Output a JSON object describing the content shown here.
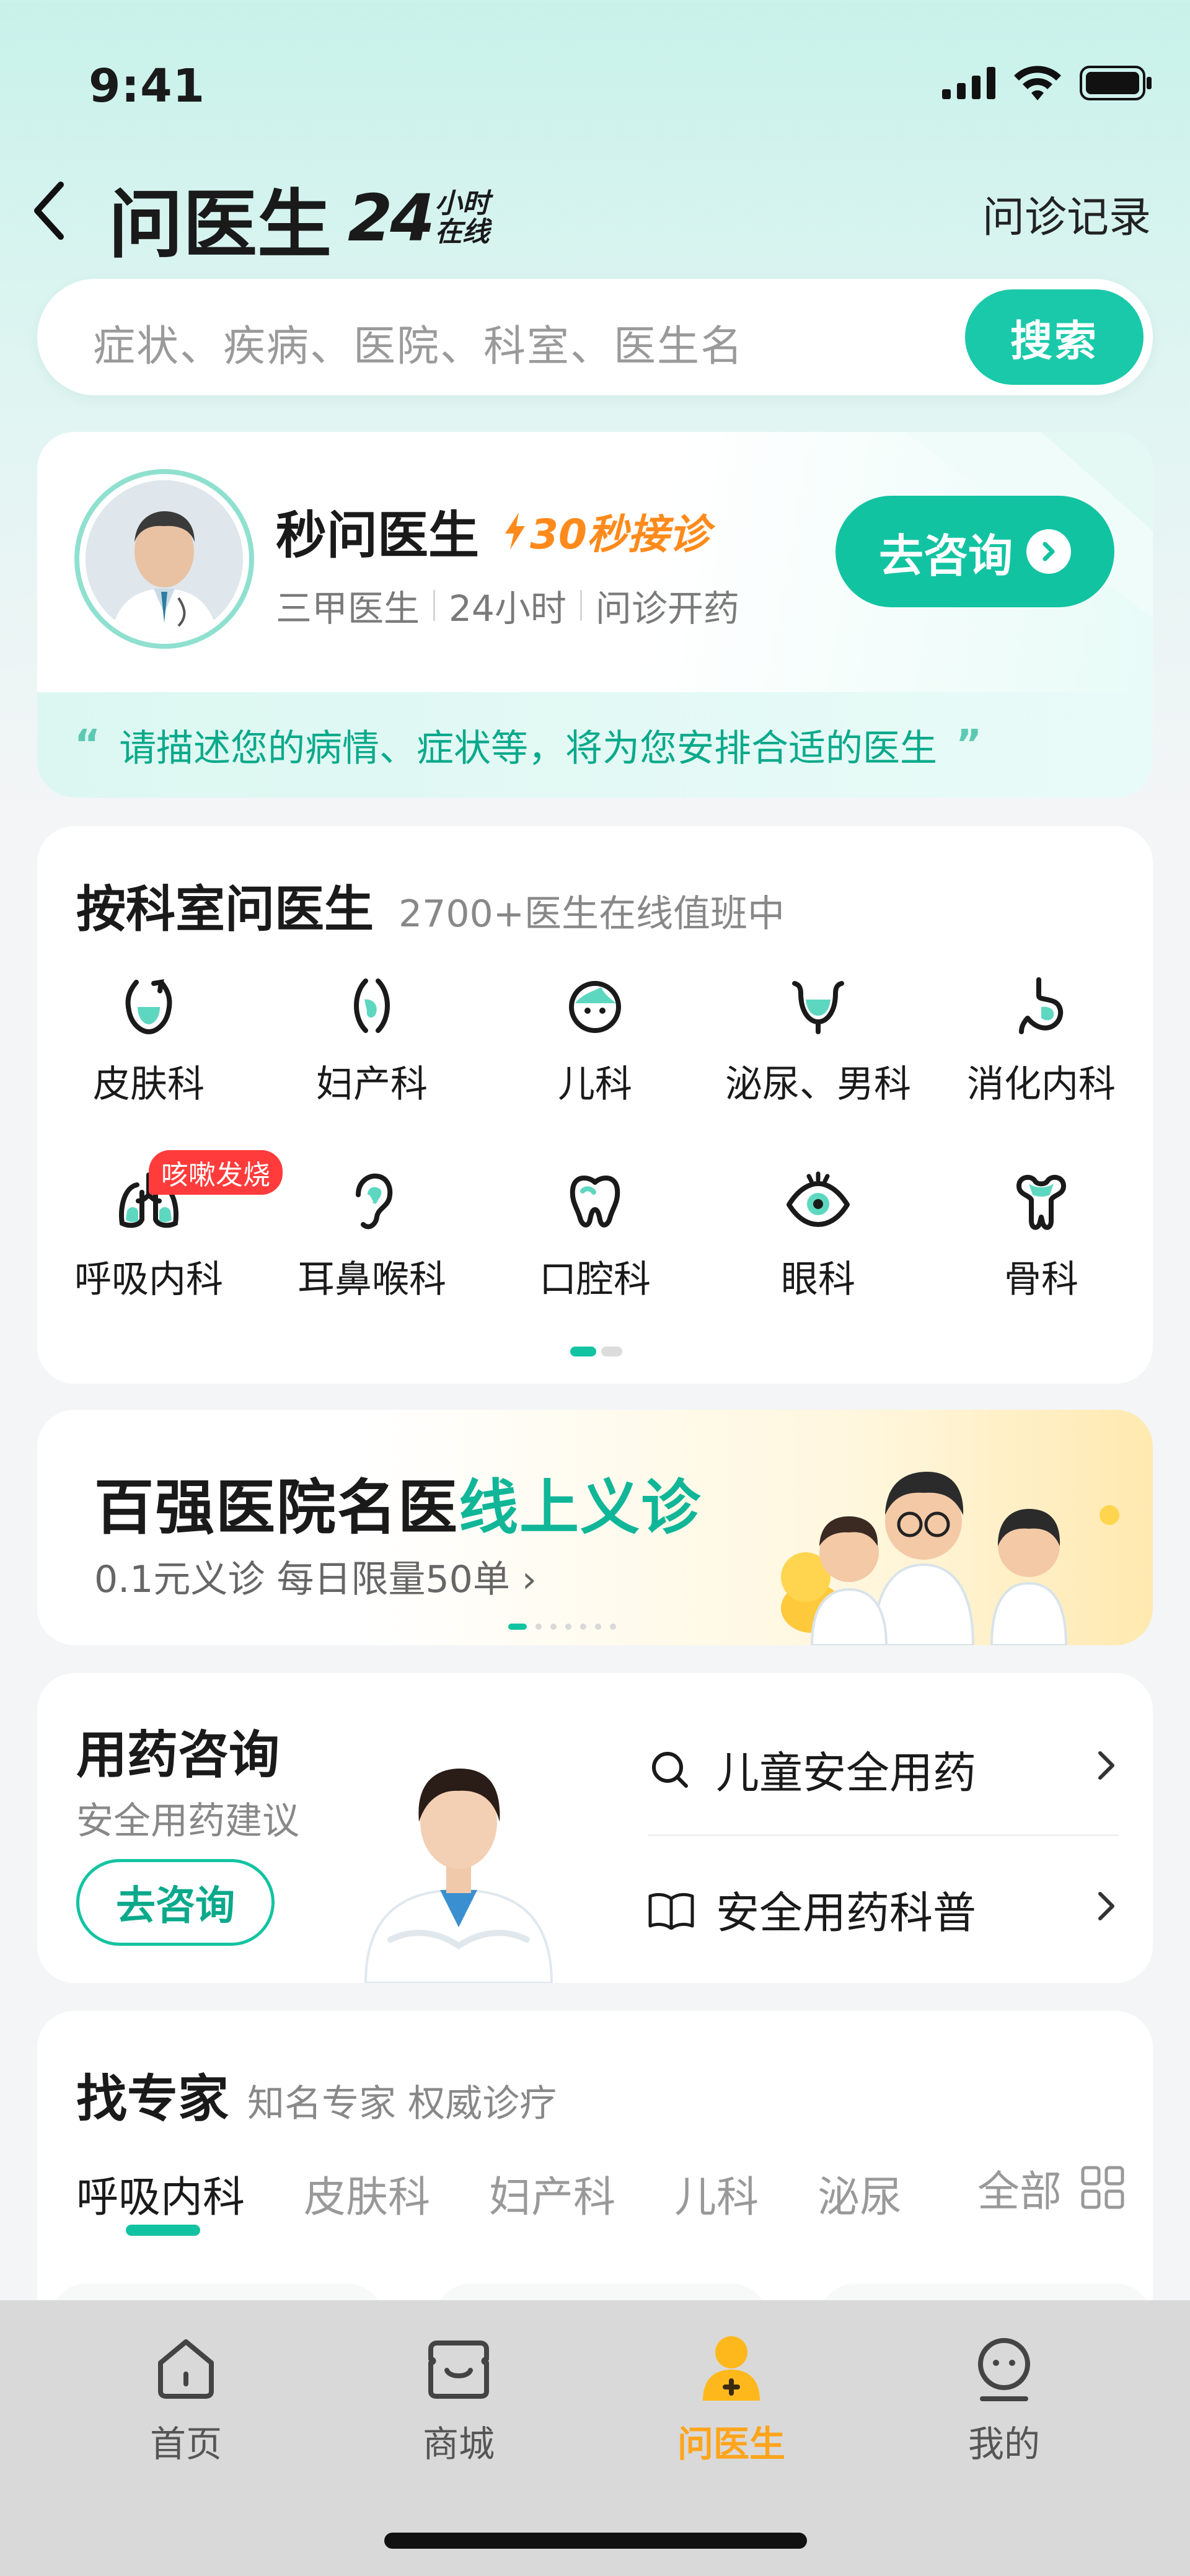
{
  "status_bar": {
    "time": "9:41"
  },
  "nav": {
    "title": "问医生",
    "badge_num": "24",
    "badge_top": "小时",
    "badge_bottom": "在线",
    "record_label": "问诊记录"
  },
  "search": {
    "placeholder": "症状、疾病、医院、科室、医生名",
    "button_label": "搜索"
  },
  "quick_consult": {
    "name": "秒问医生",
    "tag": "30秒接诊",
    "features": [
      "三甲医生",
      "24小时",
      "问诊开药"
    ],
    "button_label": "去咨询",
    "tip": "请描述您的病情、症状等，将为您安排合适的医生"
  },
  "departments": {
    "title": "按科室问医生",
    "subtitle": "2700+医生在线值班中",
    "items": [
      {
        "label": "皮肤科",
        "icon": "skin-icon"
      },
      {
        "label": "妇产科",
        "icon": "obstetrics-icon"
      },
      {
        "label": "儿科",
        "icon": "child-face-icon"
      },
      {
        "label": "泌尿、男科",
        "icon": "bladder-icon"
      },
      {
        "label": "消化内科",
        "icon": "stomach-icon"
      },
      {
        "label": "呼吸内科",
        "icon": "lungs-icon",
        "badge": "咳嗽发烧"
      },
      {
        "label": "耳鼻喉科",
        "icon": "ear-icon"
      },
      {
        "label": "口腔科",
        "icon": "tooth-icon"
      },
      {
        "label": "眼科",
        "icon": "eye-icon"
      },
      {
        "label": "骨科",
        "icon": "bone-icon"
      }
    ],
    "page_index": 1,
    "page_count": 2
  },
  "banner": {
    "title_main": "百强医院名医",
    "title_highlight": "线上义诊",
    "subtitle": "0.1元义诊 每日限量50单",
    "chevron": "›",
    "page_index": 1,
    "page_count": 7
  },
  "medication": {
    "title": "用药咨询",
    "subtitle": "安全用药建议",
    "button_label": "去咨询",
    "links": [
      {
        "label": "儿童安全用药",
        "icon": "search-icon"
      },
      {
        "label": "安全用药科普",
        "icon": "book-icon"
      }
    ]
  },
  "experts": {
    "title": "找专家",
    "subtitle": "知名专家 权威诊疗",
    "tabs": [
      "呼吸内科",
      "皮肤科",
      "妇产科",
      "儿科",
      "泌尿"
    ],
    "active_tab": 0,
    "all_label": "全部"
  },
  "tabbar": {
    "items": [
      {
        "label": "首页",
        "icon": "home-icon"
      },
      {
        "label": "商城",
        "icon": "shop-icon"
      },
      {
        "label": "问医生",
        "icon": "doctor-icon",
        "active": true
      },
      {
        "label": "我的",
        "icon": "profile-icon"
      }
    ]
  },
  "colors": {
    "accent": "#12c3a1",
    "accent_text": "#0aa98b",
    "orange": "#ff8a1c",
    "tab_active": "#ffa41b",
    "badge_red": "#ff3b3b"
  }
}
